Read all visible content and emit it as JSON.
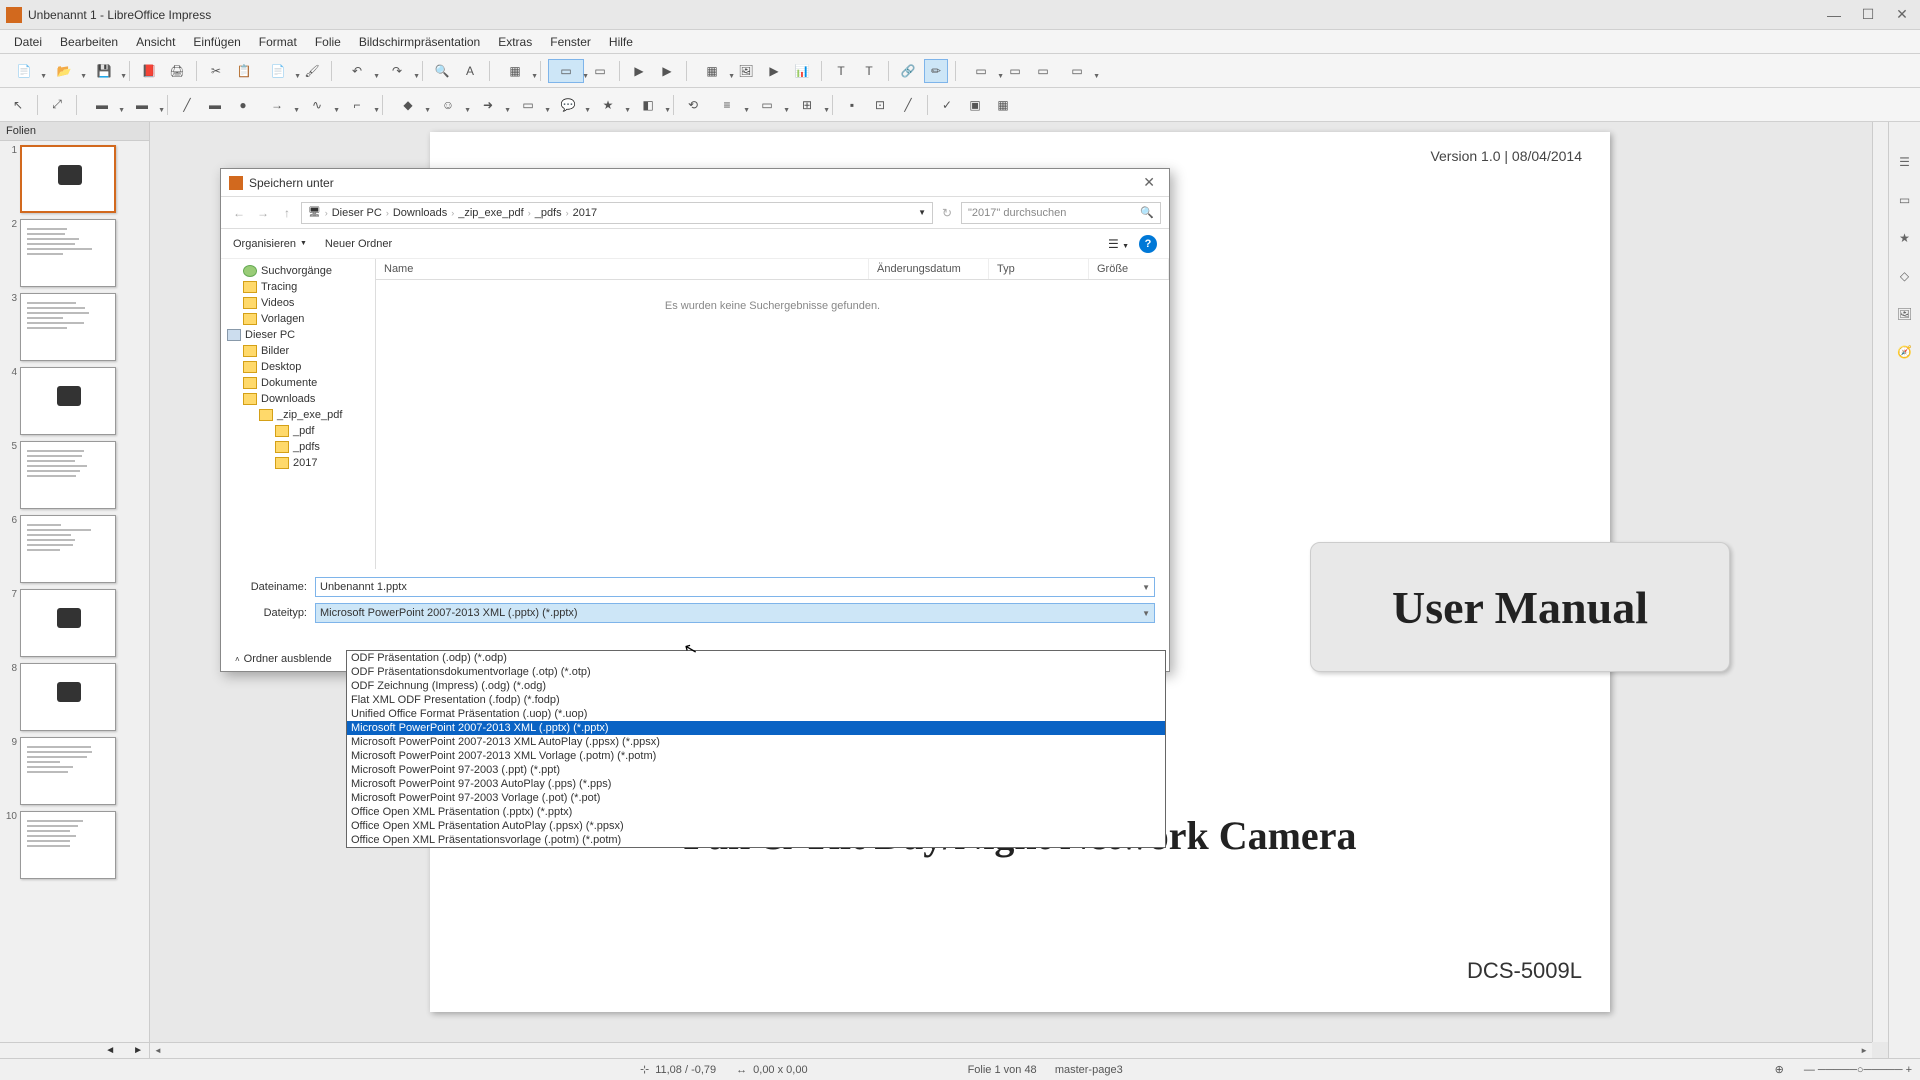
{
  "window": {
    "title": "Unbenannt 1 - LibreOffice Impress"
  },
  "menu": [
    "Datei",
    "Bearbeiten",
    "Ansicht",
    "Einfügen",
    "Format",
    "Folie",
    "Bildschirmpräsentation",
    "Extras",
    "Fenster",
    "Hilfe"
  ],
  "slide_panel": {
    "title": "Folien",
    "count": 10
  },
  "slide_content": {
    "version": "Version 1.0 | 08/04/2014",
    "user_manual": "User Manual",
    "product_title": "Pan & Tilt Day/Night Network Camera",
    "model": "DCS-5009L"
  },
  "save_dialog": {
    "title": "Speichern unter",
    "breadcrumb": [
      "Dieser PC",
      "Downloads",
      "_zip_exe_pdf",
      "_pdfs",
      "2017"
    ],
    "search_placeholder": "\"2017\" durchsuchen",
    "organize": "Organisieren",
    "new_folder": "Neuer Ordner",
    "columns": {
      "name": "Name",
      "date": "Änderungsdatum",
      "type": "Typ",
      "size": "Größe"
    },
    "empty_msg": "Es wurden keine Suchergebnisse gefunden.",
    "tree": [
      {
        "label": "Suchvorgänge",
        "indent": 1,
        "kind": "search"
      },
      {
        "label": "Tracing",
        "indent": 1,
        "kind": "folder"
      },
      {
        "label": "Videos",
        "indent": 1,
        "kind": "folder"
      },
      {
        "label": "Vorlagen",
        "indent": 1,
        "kind": "folder"
      },
      {
        "label": "Dieser PC",
        "indent": 0,
        "kind": "drive"
      },
      {
        "label": "Bilder",
        "indent": 1,
        "kind": "folder"
      },
      {
        "label": "Desktop",
        "indent": 1,
        "kind": "folder"
      },
      {
        "label": "Dokumente",
        "indent": 1,
        "kind": "folder"
      },
      {
        "label": "Downloads",
        "indent": 1,
        "kind": "folder"
      },
      {
        "label": "_zip_exe_pdf",
        "indent": 2,
        "kind": "folder"
      },
      {
        "label": "_pdf",
        "indent": 3,
        "kind": "folder"
      },
      {
        "label": "_pdfs",
        "indent": 3,
        "kind": "folder"
      },
      {
        "label": "2017",
        "indent": 3,
        "kind": "folder"
      }
    ],
    "filename_label": "Dateiname:",
    "filename_value": "Unbenannt 1.pptx",
    "filetype_label": "Dateityp:",
    "filetype_value": "Microsoft PowerPoint 2007-2013 XML (.pptx) (*.pptx)",
    "hide_folders": "Ordner ausblende"
  },
  "filetype_options": [
    "ODF Präsentation (.odp) (*.odp)",
    "ODF Präsentationsdokumentvorlage (.otp) (*.otp)",
    "ODF Zeichnung (Impress) (.odg) (*.odg)",
    "Flat XML ODF Presentation (.fodp) (*.fodp)",
    "Unified Office Format Präsentation (.uop) (*.uop)",
    "Microsoft PowerPoint 2007-2013 XML (.pptx) (*.pptx)",
    "Microsoft PowerPoint 2007-2013 XML AutoPlay (.ppsx) (*.ppsx)",
    "Microsoft PowerPoint 2007-2013 XML Vorlage (.potm) (*.potm)",
    "Microsoft PowerPoint 97-2003 (.ppt) (*.ppt)",
    "Microsoft PowerPoint 97-2003 AutoPlay (.pps) (*.pps)",
    "Microsoft PowerPoint 97-2003 Vorlage (.pot) (*.pot)",
    "Office Open XML Präsentation (.pptx) (*.pptx)",
    "Office Open XML Präsentation AutoPlay (.ppsx) (*.ppsx)",
    "Office Open XML Präsentationsvorlage (.potm) (*.potm)"
  ],
  "filetype_selected_index": 5,
  "statusbar": {
    "coords": "11,08 / -0,79",
    "size": "0,00 x 0,00",
    "slide_info": "Folie 1 von 48",
    "master": "master-page3"
  }
}
